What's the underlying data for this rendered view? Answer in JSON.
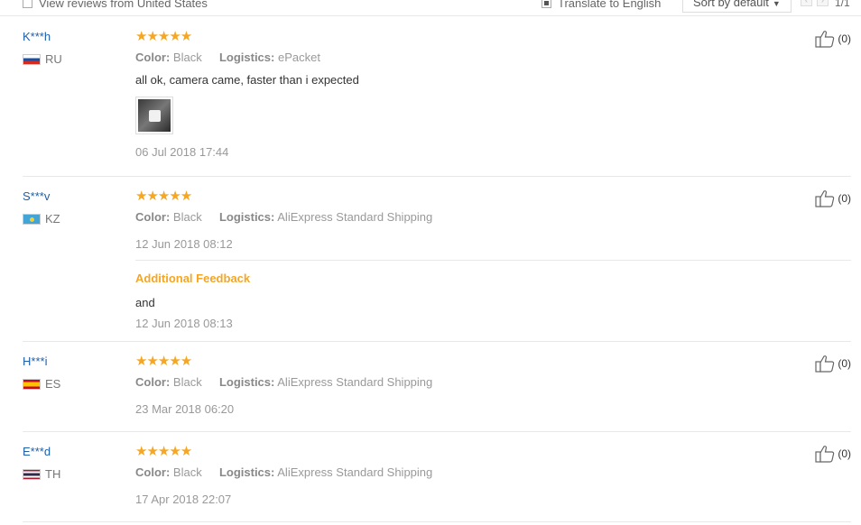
{
  "toolbar": {
    "country_filter_label": "View reviews from United States",
    "translate_label": "Translate to English",
    "sort_label": "Sort by default",
    "page_count": "1/1"
  },
  "reviews": [
    {
      "user": "K***h",
      "country": "RU",
      "flag": "russia-flag",
      "rating": 5,
      "stars": "★★★★★",
      "color_label": "Color:",
      "color_value": "Black",
      "logistics_label": "Logistics:",
      "logistics_value": "ePacket",
      "text": "all ok, camera came, faster than i expected",
      "has_photo": true,
      "date": "06 Jul 2018 17:44",
      "helpful": "(0)"
    },
    {
      "user": "S***v",
      "country": "KZ",
      "flag": "kazakhstan-flag",
      "rating": 5,
      "stars": "★★★★★",
      "color_label": "Color:",
      "color_value": "Black",
      "logistics_label": "Logistics:",
      "logistics_value": "AliExpress Standard Shipping",
      "date": "12 Jun 2018 08:12",
      "additional": {
        "title": "Additional Feedback",
        "text": "and",
        "date": "12 Jun 2018 08:13"
      },
      "helpful": "(0)"
    },
    {
      "user": "H***i",
      "country": "ES",
      "flag": "spain-flag",
      "rating": 5,
      "stars": "★★★★★",
      "color_label": "Color:",
      "color_value": "Black",
      "logistics_label": "Logistics:",
      "logistics_value": "AliExpress Standard Shipping",
      "date": "23 Mar 2018 06:20",
      "helpful": "(0)"
    },
    {
      "user": "E***d",
      "country": "TH",
      "flag": "thailand-flag",
      "rating": 5,
      "stars": "★★★★★",
      "color_label": "Color:",
      "color_value": "Black",
      "logistics_label": "Logistics:",
      "logistics_value": "AliExpress Standard Shipping",
      "date": "17 Apr 2018 22:07",
      "helpful": "(0)"
    }
  ],
  "colors": {
    "user_link": "#1f5fa6",
    "star": "#f5a623",
    "muted": "#999999",
    "divider": "#e8e8e8"
  }
}
